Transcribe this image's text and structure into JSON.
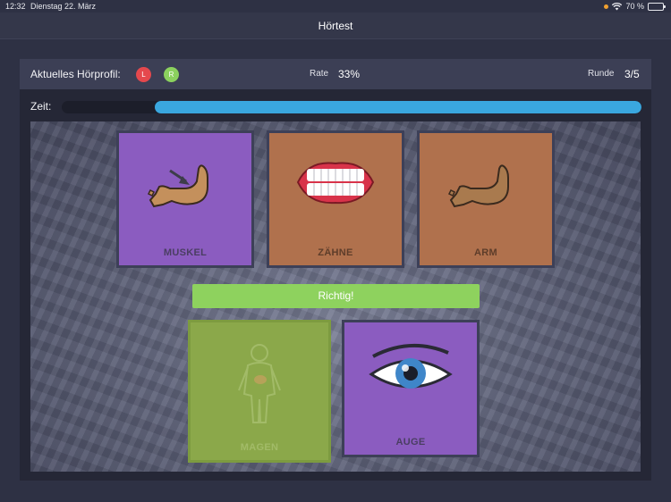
{
  "status_bar": {
    "time": "12:32",
    "date": "Dienstag 22. März",
    "battery": "70 %"
  },
  "nav": {
    "title": "Hörtest"
  },
  "info": {
    "profile_label": "Aktuelles Hörprofil:",
    "ear_left": "L",
    "ear_right": "R",
    "rate_label": "Rate",
    "rate_value": "33%",
    "round_label": "Runde",
    "round_value": "3/5"
  },
  "timer": {
    "label": "Zeit:",
    "remaining_fraction": 0.84
  },
  "cards": {
    "muskel": "MUSKEL",
    "zaehne": "ZÄHNE",
    "arm": "ARM",
    "magen": "MAGEN",
    "auge": "AUGE"
  },
  "result": {
    "text": "Richtig!"
  },
  "colors": {
    "purple_card": "#8b5cc0",
    "brown_card": "#b0714d",
    "correct_green": "#8ed25e",
    "timer_blue": "#3aa7df",
    "ear_left_red": "#e5484d",
    "ear_right_green": "#8bd15e"
  }
}
